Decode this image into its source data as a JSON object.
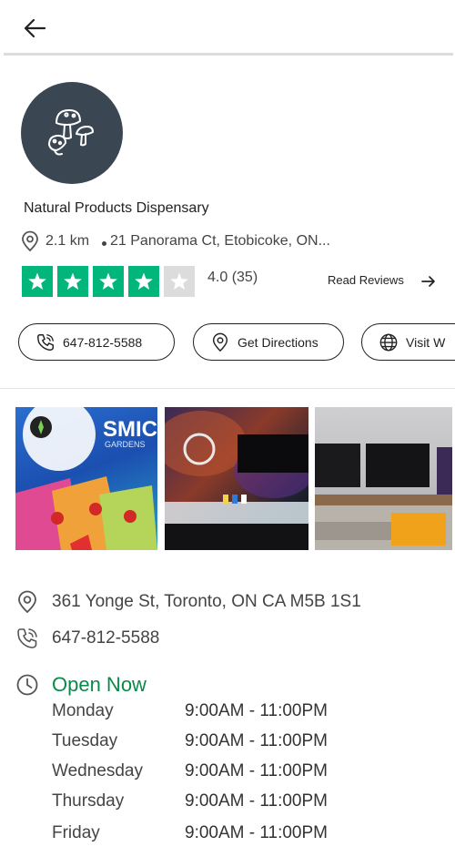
{
  "header": {
    "back_icon": "arrow-left-icon"
  },
  "store": {
    "logo_icon": "mushroom-icon",
    "name": "Natural Products Dispensary",
    "distance": "2.1 km",
    "short_address": "21 Panorama Ct, Etobicoke, ON...",
    "rating": 4.0,
    "rating_text": "4.0 (35)",
    "stars_filled": 4,
    "stars_total": 5,
    "read_reviews_label": "Read Reviews"
  },
  "actions": {
    "call_label": "647-812-5588",
    "directions_label": "Get Directions",
    "website_label": "Visit W"
  },
  "photos": {
    "photo1_text": "SMIC",
    "photo1_subtext": "GARDENS"
  },
  "contact": {
    "address": "361 Yonge St, Toronto, ON CA M5B 1S1",
    "phone": "647-812-5588",
    "status": "Open Now"
  },
  "hours": [
    {
      "day": "Monday",
      "time": "9:00AM - 11:00PM"
    },
    {
      "day": "Tuesday",
      "time": "9:00AM - 11:00PM"
    },
    {
      "day": "Wednesday",
      "time": "9:00AM - 11:00PM"
    },
    {
      "day": "Thursday",
      "time": "9:00AM - 11:00PM"
    },
    {
      "day": "Friday",
      "time": "9:00AM - 11:00PM"
    }
  ],
  "colors": {
    "star_green": "#00b67a",
    "open_green": "#0a8a4a",
    "logo_bg": "#3a4753"
  }
}
